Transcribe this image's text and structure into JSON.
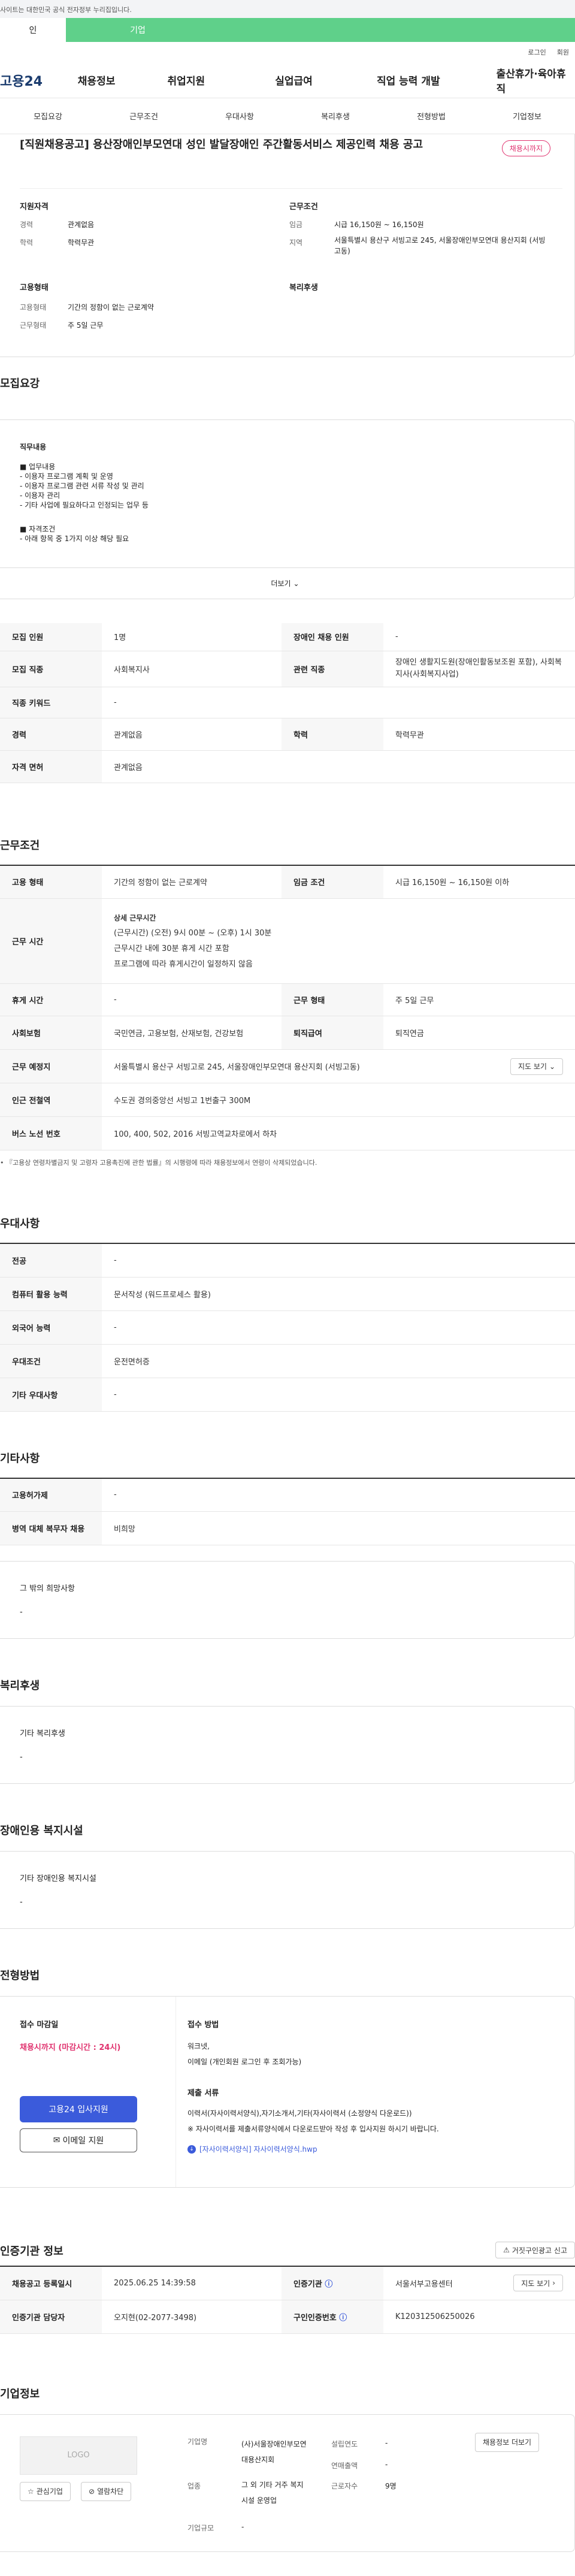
{
  "gov_notice": "사이트는 대한민국 공식 전자정부 누리집입니다.",
  "user_tabs": [
    "인",
    "기업"
  ],
  "util": [
    "로그인",
    "회원"
  ],
  "brand": "고용24",
  "gnb": [
    "채용정보",
    "취업지원",
    "실업급여",
    "직업 능력 개발",
    "출산휴가·육아휴직"
  ],
  "sub_tabs": [
    "모집요강",
    "근무조건",
    "우대사항",
    "복리후생",
    "전형방법",
    "기업정보"
  ],
  "job": {
    "title": "[직원채용공고] 용산장애인부모연대 성인 발달장애인 주간활동서비스 제공인력 채용 공고",
    "status_badge": "채용시까지",
    "req_title": "지원자격",
    "career_label": "경력",
    "career": "관계없음",
    "edu_label": "학력",
    "edu": "학력무관",
    "cond_title": "근무조건",
    "wage_label": "임금",
    "wage": "시급 16,150원 ~ 16,150원",
    "area_label": "지역",
    "area": "서울특별시 용산구 서빙고로 245, 서울장애인부모연대 용산지회 (서빙고동)",
    "form_title": "고용형태",
    "emp_label": "고용형태",
    "emp": "기간의 정함이 없는 근로계약",
    "worktype_label": "근무형태",
    "worktype": "주 5일 근무",
    "welfare_title": "복리후생"
  },
  "recruit": {
    "title": "모집요강",
    "body_title": "직무내용",
    "lines": [
      "■ 업무내용",
      "- 이용자 프로그램 계획 및 운영",
      "- 이용자 프로그램  관련 서류 작성 및 관리",
      "- 이용자 관리",
      "- 기타 사업에 필요하다고 인정되는 업무 등",
      "",
      "■ 자격조건",
      "-  아래 항목 중 1가지 이상 해당 필요"
    ],
    "more": "더보기",
    "rows": [
      {
        "k1": "모집 인원",
        "v1": "1명",
        "k2": "장애인 채용 인원",
        "v2": "-"
      },
      {
        "k1": "모집 직종",
        "v1": "사회복지사",
        "k2": "관련 직종",
        "v2": "장애인 생활지도원(장애인활동보조원 포함), 사회복지사(사회복지사업)"
      },
      {
        "k1": "직종 키워드",
        "v1": "-"
      },
      {
        "k1": "경력",
        "v1": "관계없음",
        "k2": "학력",
        "v2": "학력무관"
      },
      {
        "k1": "자격 면허",
        "v1": "관계없음"
      }
    ]
  },
  "work": {
    "title": "근무조건",
    "emp_label": "고용 형태",
    "emp": "기간의 정함이 없는 근로계약",
    "wage_label": "임금 조건",
    "wage": "시급 16,150원 ~ 16,150원 이하",
    "time_label": "근무 시간",
    "time_lines": [
      "상세 근무시간",
      "(근무시간) (오전) 9시 00분 ~ (오후) 1시 30분",
      "근무시간 내에 30분 휴게 시간 포함",
      "프로그램에 따라 휴게시간이 일정하지 않음"
    ],
    "holiday_label": "휴게 시간",
    "holiday": "-",
    "type_label": "근무 형태",
    "type": "주 5일 근무",
    "insure_label": "사회보험",
    "insure": "국민연금, 고용보험, 산재보험, 건강보험",
    "retire_label": "퇴직급여",
    "retire": "퇴직연금",
    "place_label": "근무 예정지",
    "place": "서울특별시 용산구 서빙고로 245, 서울장애인부모연대 용산지회 (서빙고동)",
    "map_btn": "지도 보기",
    "subway_label": "인근 전철역",
    "subway": "수도권 경의중앙선 서빙고 1번출구 300M",
    "bus_label": "버스 노선 번호",
    "bus": "100, 400, 502, 2016 서빙고역교차로에서 하차",
    "note": "『고용상 연령차별금지 및 고령자 고용촉진에 관한 법률』의 시행령에 따라 채용정보에서 연령이 삭제되었습니다."
  },
  "pref": {
    "title": "우대사항",
    "rows": [
      {
        "k": "전공",
        "v": "-"
      },
      {
        "k": "컴퓨터 활용 능력",
        "v": "문서작성 (워드프로세스 활용)"
      },
      {
        "k": "외국어 능력",
        "v": "-"
      },
      {
        "k": "우대조건",
        "v": "운전면허증"
      },
      {
        "k": "기타 우대사항",
        "v": "-"
      }
    ]
  },
  "etc": {
    "title": "기타사항",
    "rows": [
      {
        "k": "고용허가제",
        "v": "-"
      },
      {
        "k": "병역 대체 복무자 채용",
        "v": "비희망"
      }
    ],
    "box_title": "그 밖의 희망사항",
    "box_val": "-"
  },
  "welfare": {
    "title": "복리후생",
    "box_title": "기타 복리후생",
    "box_val": "-"
  },
  "facility": {
    "title": "장애인용 복지시설",
    "box_title": "기타 장애인용 복지시설",
    "box_val": "-"
  },
  "screen": {
    "title": "전형방법",
    "deadline_label": "접수 마감일",
    "deadline": "채용시까지 (마감시간 : 24시)",
    "apply_btn": "고용24 입사지원",
    "email_btn": "이메일 지원",
    "method_label": "접수 방법",
    "method_lines": [
      "워크넷,",
      "이메일 (개인회원 로그인 후 조회가능)"
    ],
    "doc_label": "제출 서류",
    "doc_lines": [
      "이력서(자사이력서양식),자기소개서,기타(자사이력서 (소정양식 다운로드))",
      "※ 자사이력서를 제출서류양식에서 다운로드받아 작성 후 입사지원 하시기 바랍니다."
    ],
    "file": "[자사이력서양식] 자사이력서양식.hwp"
  },
  "auth": {
    "title": "인증기관 정보",
    "report_btn": "거짓구인광고 신고",
    "reg_label": "채용공고 등록일시",
    "reg": "2025.06.25 14:39:58",
    "agency_label": "인증기관",
    "agency": "서울서부고용센터",
    "map_btn": "지도 보기",
    "mgr_label": "인증기관 담당자",
    "mgr": "오지현(02-2077-3498)",
    "num_label": "구인인증번호",
    "num": "K120312506250026"
  },
  "company": {
    "title": "기업정보",
    "logo": "LOGO",
    "fav_btn": "관심기업",
    "block_btn": "열람차단",
    "name_label": "기업명",
    "name": "(사)서울장애인부모연대용산지회",
    "ind_label": "업종",
    "ind": "그 외 기타 거주 복지시설 운영업",
    "scale_label": "기업규모",
    "scale": "-",
    "est_label": "설립연도",
    "est": "-",
    "sales_label": "연매출액",
    "sales": "-",
    "emp_label": "근로자수",
    "emp": "9명",
    "more_btn": "채용정보 더보기"
  }
}
